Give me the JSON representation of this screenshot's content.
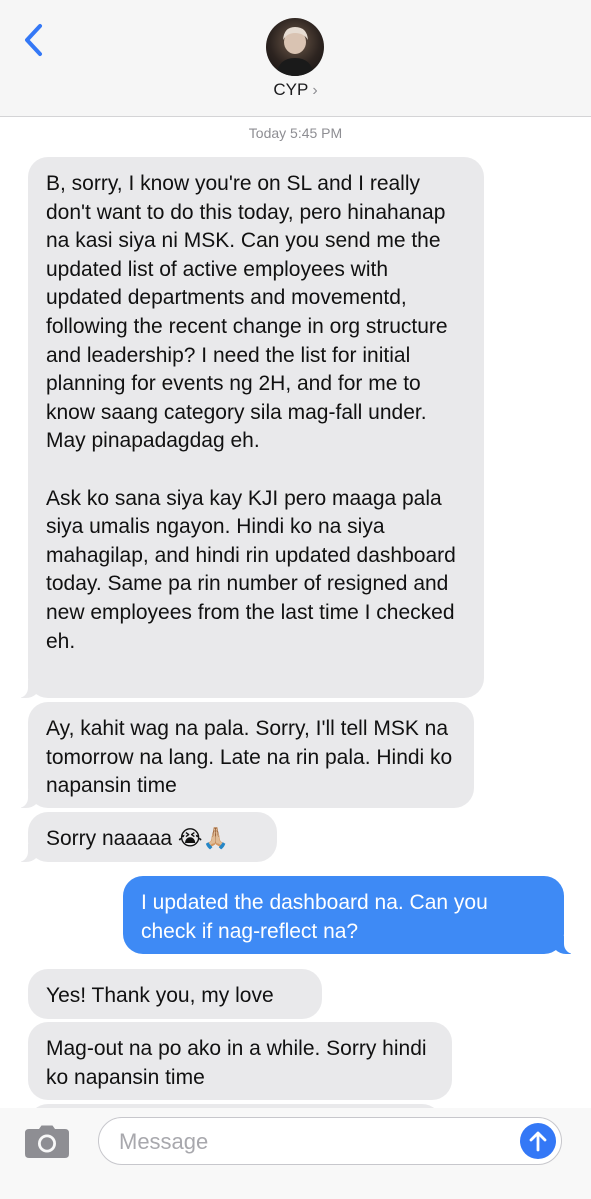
{
  "header": {
    "contact_name": "CYP",
    "chevron": "›",
    "back_icon": "chevron-left-icon",
    "avatar": "contact-avatar-photo"
  },
  "conversation": {
    "timestamp": "Today 5:45 PM",
    "messages": [
      {
        "direction": "incoming",
        "text": "B, sorry, I know you're on SL and I really don't want to do this today, pero hinahanap na kasi siya ni MSK. Can you send me the updated list of active employees with updated departments and movementd, following the recent change in org structure and leadership? I need the list for initial planning for events ng 2H, and for me to know saang category sila mag-fall under. May pinapadagdag eh.\n\nAsk ko sana siya kay KJI pero maaga pala siya umalis ngayon. Hindi ko na siya mahagilap, and hindi rin updated dashboard today. Same pa rin number of resigned and new employees from the last time I checked eh."
      },
      {
        "direction": "incoming",
        "text": "Ay, kahit wag na pala. Sorry, I'll tell MSK na tomorrow na lang. Late na rin pala. Hindi ko napansin time"
      },
      {
        "direction": "incoming",
        "text": "Sorry naaaaa 😭🙏🏼"
      },
      {
        "direction": "outgoing",
        "text": "I updated the dashboard na. Can you check if nag-reflect na?"
      },
      {
        "direction": "incoming",
        "text": "Yes! Thank you, my love"
      },
      {
        "direction": "incoming",
        "text": "Mag-out na po ako in a while. Sorry hindi ko napansin time"
      },
      {
        "direction": "incoming",
        "text": ""
      }
    ]
  },
  "composer": {
    "placeholder": "Message",
    "value": "",
    "camera_icon": "camera-icon",
    "send_icon": "arrow-up-icon"
  },
  "colors": {
    "incoming_bubble": "#e9e9eb",
    "outgoing_bubble": "#3e8af5",
    "accent": "#3478f6"
  }
}
